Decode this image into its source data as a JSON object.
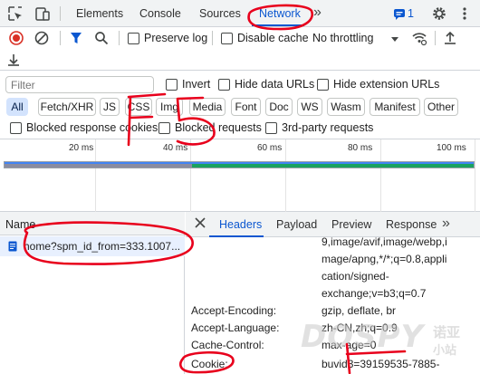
{
  "tabs": [
    "Elements",
    "Console",
    "Sources",
    "Network"
  ],
  "more_tabs": "»",
  "issues_count": "1",
  "toolbar": {
    "preserve_log": "Preserve log",
    "disable_cache": "Disable cache",
    "throttling": "No throttling"
  },
  "filter": {
    "placeholder": "Filter",
    "invert": "Invert",
    "hide_data_urls": "Hide data URLs",
    "hide_extension_urls": "Hide extension URLs"
  },
  "type_filters": [
    "All",
    "Fetch/XHR",
    "JS",
    "CSS",
    "Img",
    "Media",
    "Font",
    "Doc",
    "WS",
    "Wasm",
    "Manifest",
    "Other"
  ],
  "options": {
    "blocked_response_cookies": "Blocked response cookies",
    "blocked_requests": "Blocked requests",
    "third_party_requests": "3rd-party requests"
  },
  "timeline": {
    "ticks": [
      "20 ms",
      "40 ms",
      "60 ms",
      "80 ms",
      "100 ms"
    ],
    "load_fraction_gray": 0.4,
    "load_fraction_green": 0.6
  },
  "requests": {
    "column_name": "Name",
    "items": [
      {
        "name": "home?spm_id_from=333.1007..."
      }
    ]
  },
  "detail": {
    "tabs": [
      "Headers",
      "Payload",
      "Preview",
      "Response"
    ],
    "more": "»",
    "accept_value_lines": [
      "9,image/avif,image/webp,i",
      "mage/apng,*/*;q=0.8,appli",
      "cation/signed-",
      "exchange;v=b3;q=0.7"
    ],
    "headers": [
      {
        "name": "Accept-Encoding:",
        "value": "gzip, deflate, br"
      },
      {
        "name": "Accept-Language:",
        "value": "zh-CN,zh;q=0.9"
      },
      {
        "name": "Cache-Control:",
        "value": "max-age=0"
      },
      {
        "name": "Cookie:",
        "value": "buvid3=39159535-7885-"
      }
    ]
  },
  "annotation": {
    "text": "F5"
  },
  "watermark": {
    "text": "DOSPY",
    "sub1": "诺亚",
    "sub2": "小站"
  },
  "colors": {
    "accent": "#0b57d0",
    "annotation": "#e8001c",
    "record": "#d93025"
  }
}
